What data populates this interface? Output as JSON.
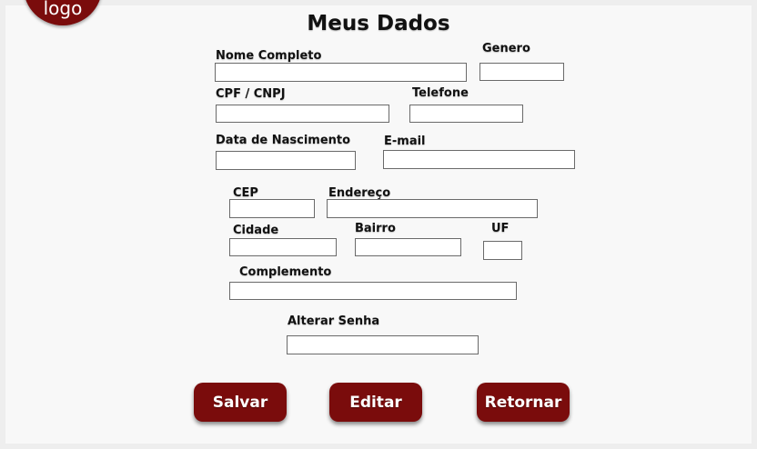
{
  "logo": {
    "text": "logo",
    "color": "#7a0c0c"
  },
  "title": "Meus Dados",
  "fields": {
    "nome_completo": {
      "label": "Nome Completo",
      "value": ""
    },
    "genero": {
      "label": "Genero",
      "value": ""
    },
    "cpf_cnpj": {
      "label": "CPF / CNPJ",
      "value": ""
    },
    "telefone": {
      "label": "Telefone",
      "value": ""
    },
    "data_nascimento": {
      "label": "Data de Nascimento",
      "value": ""
    },
    "email": {
      "label": "E-mail",
      "value": ""
    },
    "cep": {
      "label": "CEP",
      "value": ""
    },
    "endereco": {
      "label": "Endereço",
      "value": ""
    },
    "cidade": {
      "label": "Cidade",
      "value": ""
    },
    "bairro": {
      "label": "Bairro",
      "value": ""
    },
    "uf": {
      "label": "UF",
      "value": ""
    },
    "complemento": {
      "label": "Complemento",
      "value": ""
    },
    "alterar_senha": {
      "label": "Alterar Senha",
      "value": ""
    }
  },
  "buttons": {
    "salvar": "Salvar",
    "editar": "Editar",
    "retornar": "Retornar"
  },
  "colors": {
    "accent": "#7a0c0c",
    "background": "#f8f8f8"
  }
}
